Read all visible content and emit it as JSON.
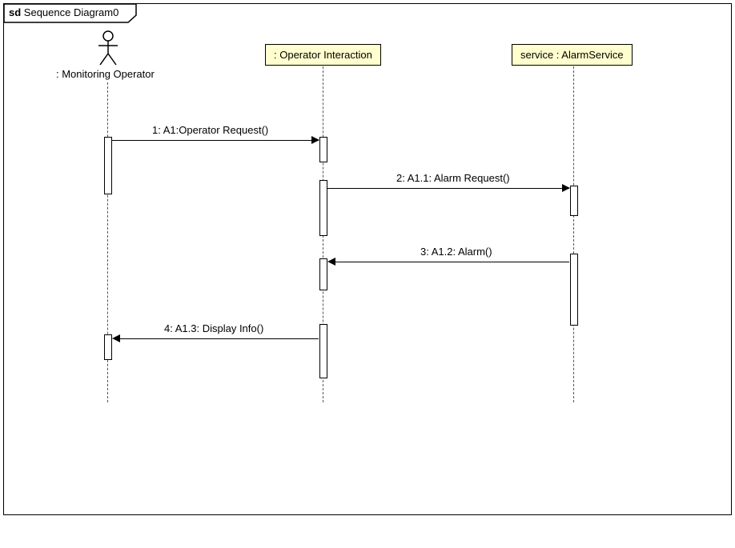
{
  "frame": {
    "prefix": "sd",
    "title": "Sequence Diagram0"
  },
  "lifelines": {
    "actor": {
      "label": ": Monitoring Operator"
    },
    "component1": {
      "label": ": Operator Interaction"
    },
    "component2": {
      "label": "service : AlarmService"
    }
  },
  "messages": {
    "m1": {
      "label": "1: A1:Operator Request()"
    },
    "m2": {
      "label": "2: A1.1: Alarm Request()"
    },
    "m3": {
      "label": "3: A1.2: Alarm()"
    },
    "m4": {
      "label": "4: A1.3: Display Info()"
    }
  },
  "chart_data": {
    "type": "sequence-diagram",
    "title": "Sequence Diagram0",
    "lifelines": [
      {
        "id": "operator",
        "type": "actor",
        "name": "Monitoring Operator"
      },
      {
        "id": "interaction",
        "type": "component",
        "name": "Operator Interaction"
      },
      {
        "id": "service",
        "type": "component",
        "instance": "service",
        "class": "AlarmService"
      }
    ],
    "messages": [
      {
        "seq": "1",
        "id": "A1",
        "name": "Operator Request",
        "from": "operator",
        "to": "interaction",
        "direction": "call"
      },
      {
        "seq": "2",
        "id": "A1.1",
        "name": "Alarm Request",
        "from": "interaction",
        "to": "service",
        "direction": "call"
      },
      {
        "seq": "3",
        "id": "A1.2",
        "name": "Alarm",
        "from": "service",
        "to": "interaction",
        "direction": "return"
      },
      {
        "seq": "4",
        "id": "A1.3",
        "name": "Display Info",
        "from": "interaction",
        "to": "operator",
        "direction": "return"
      }
    ]
  }
}
